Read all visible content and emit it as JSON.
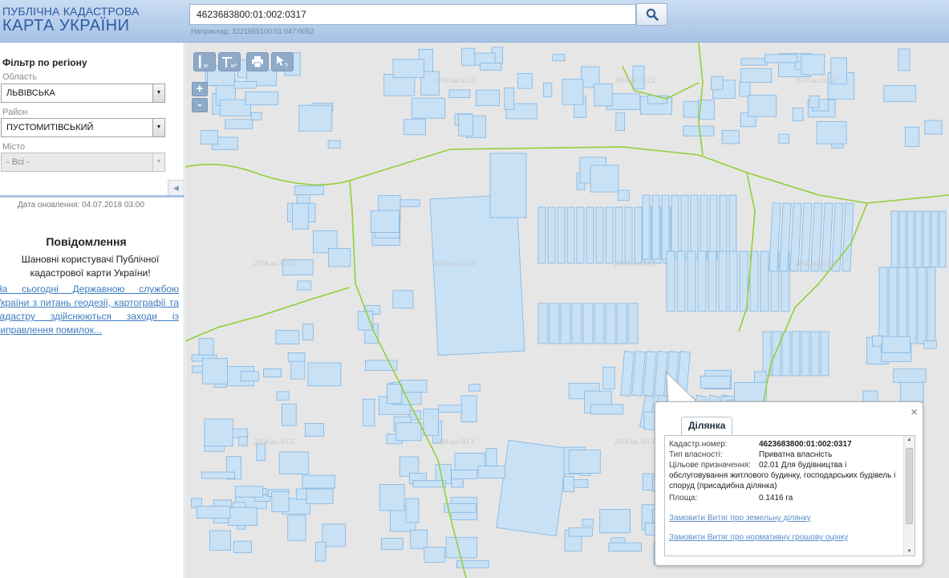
{
  "header": {
    "logo_line1": "ПУБЛІЧНА КАДАСТРОВА",
    "logo_line2": "КАРТА УКРАЇНИ",
    "search_value": "4623683800:01:002:0317",
    "search_hint": "Наприклад: 3221655100:01:047:0052",
    "search_icon": "magnifier-icon"
  },
  "sidebar": {
    "filter_title": "Фільтр по регіону",
    "oblast_label": "Область",
    "oblast_value": "ЛЬВІВСЬКА",
    "rayon_label": "Район",
    "rayon_value": "ПУСТОМИТІВСЬКИЙ",
    "misto_label": "Місто",
    "misto_value": "- Всі -",
    "update_text": "Дата оновлення: 04.07.2018 03:00",
    "notice_title": "Повідомлення",
    "notice_text": "Шановні користувачі Публічної кадастрової карти України!",
    "notice_link": "На сьогодні Державною службою України з питань геодезії, картографії та кадастру здійснюються заходи із виправлення помилок..."
  },
  "map": {
    "tools": [
      {
        "icon": "measure-length-icon",
        "label": "м"
      },
      {
        "icon": "measure-area-icon",
        "label": "м²"
      },
      {
        "icon": "print-icon",
        "label": ""
      },
      {
        "icon": "identify-icon",
        "label": "?"
      }
    ],
    "zoom_in": "+",
    "zoom_out": "-",
    "watermark": "2018.ua.SLCC",
    "colors": {
      "background": "#e6e6e6",
      "parcel_fill": "#c9e1f5",
      "parcel_stroke": "#7fb6e4",
      "boundary": "#93cf3a"
    }
  },
  "popup": {
    "tab": "Ділянка",
    "close": "×",
    "rows": [
      {
        "key": "Кадастр.номер:",
        "value": "4623683800:01:002:0317"
      },
      {
        "key": "Тип власності:",
        "value": "Приватна власність"
      },
      {
        "key": "Цільове призначення:",
        "value": "02.01 Для будівництва і"
      },
      {
        "key": "",
        "value": "обслуговування житлового будинку, господарських будівель і споруд (присадибна ділянка)"
      },
      {
        "key": "Площа:",
        "value": "0.1416 га"
      }
    ],
    "link1": "Замовити Витяг про земельну ділянку",
    "link2": "Замовити Витяг про нормативну грошову оцінку"
  }
}
